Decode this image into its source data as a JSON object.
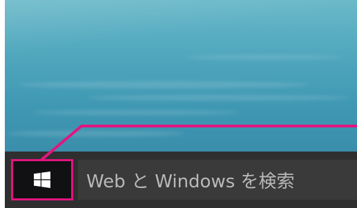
{
  "taskbar": {
    "start_button_icon": "windows-logo-icon",
    "search_placeholder": "Web と Windows を検索"
  },
  "annotation": {
    "color": "#e2157f"
  },
  "colors": {
    "taskbar": "#2f2f30",
    "start_button": "#111113",
    "search_text": "#b9b9b9"
  }
}
